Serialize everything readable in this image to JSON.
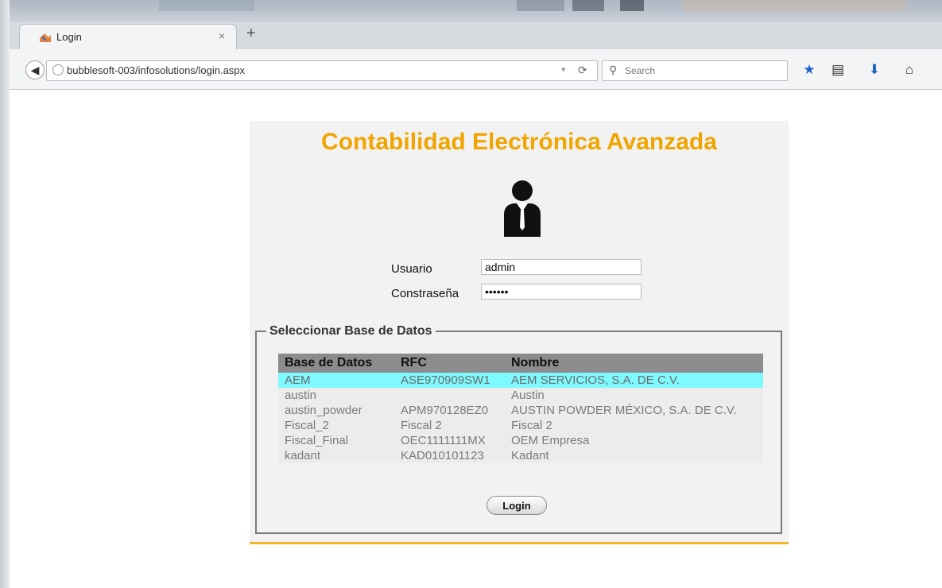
{
  "browser": {
    "tab_title": "Login",
    "new_tab_symbol": "+",
    "url": "bubblesoft-003/infosolutions/login.aspx",
    "search_placeholder": "Search"
  },
  "page": {
    "app_title": "Contabilidad Electrónica Avanzada",
    "user_label": "Usuario",
    "user_value": "admin",
    "password_label": "Constraseña",
    "password_value": "••••••",
    "db_group_title": "Seleccionar Base de Datos",
    "table": {
      "headers": [
        "Base de Datos",
        "RFC",
        "Nombre"
      ],
      "rows": [
        [
          "AEM",
          "ASE970909SW1",
          "AEM SERVICIOS, S.A. DE C.V."
        ],
        [
          "austin",
          "",
          "Austin"
        ],
        [
          "austin_powder",
          "APM970128EZ0",
          "AUSTIN POWDER MÉXICO, S.A. DE C.V."
        ],
        [
          "Fiscal_2",
          "Fiscal 2",
          "Fiscal 2"
        ],
        [
          "Fiscal_Final",
          "OEC1111111MX",
          "OEM Empresa"
        ],
        [
          "kadant",
          "KAD010101123",
          "Kadant"
        ]
      ],
      "selected_row": 0
    },
    "login_button": "Login"
  },
  "colors": {
    "title_orange": "#f0a500",
    "selected_row": "#7efaff",
    "header_gray": "#8c8c8c",
    "accent_line": "#f0b429"
  },
  "icons": [
    "back-arrow-icon",
    "site-identity-icon",
    "reload-icon",
    "search-icon",
    "bookmark-star-icon",
    "reading-list-icon",
    "download-icon",
    "home-icon",
    "user-icon"
  ]
}
